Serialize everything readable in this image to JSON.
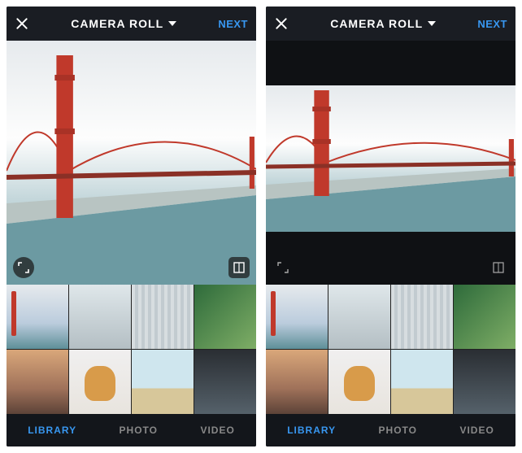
{
  "screens": {
    "left": {
      "header": {
        "title": "CAMERA ROLL",
        "next": "NEXT"
      },
      "tabs": [
        "LIBRARY",
        "PHOTO",
        "VIDEO"
      ],
      "active_tab": "LIBRARY"
    },
    "right": {
      "header": {
        "title": "CAMERA ROLL",
        "next": "NEXT"
      },
      "tabs": [
        "LIBRARY",
        "PHOTO",
        "VIDEO"
      ],
      "active_tab": "LIBRARY"
    }
  },
  "thumbnails": [
    {
      "name": "bridge",
      "selected": true
    },
    {
      "name": "boats",
      "selected": false
    },
    {
      "name": "building",
      "selected": false
    },
    {
      "name": "plants",
      "selected": false
    },
    {
      "name": "sunset",
      "selected": false
    },
    {
      "name": "dog",
      "selected": false
    },
    {
      "name": "beach",
      "selected": false
    },
    {
      "name": "dark",
      "selected": false
    }
  ],
  "colors": {
    "accent": "#3897f0"
  }
}
